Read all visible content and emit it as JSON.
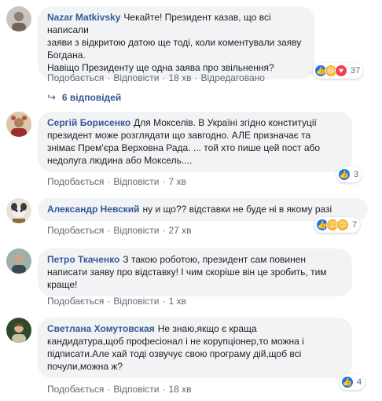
{
  "comments": [
    {
      "author": "Nazar Matkivsky",
      "lines": [
        "Чекайте! Президент казав, що всі написали",
        "заяви з відкритою датою ще тоді, коли коментували заяву",
        "Богдана.",
        "Навіщо Президенту ще одна заява про звільнення?"
      ],
      "like": "Подобається",
      "reply": "Відповісти",
      "time": "18 хв",
      "edited": "Відредаговано",
      "reaction_count": "37"
    },
    {
      "author": "Сергій Борисенко",
      "lines": [
        "Для Мокселів. В Україні згідно конституції",
        "президент може розглядати що завгодно. АЛЕ призначає та",
        "знімає Прем'єра Верховна Рада. ... той хто пише цей пост або",
        "недолуга людина або Моксель...."
      ],
      "like": "Подобається",
      "reply": "Відповісти",
      "time": "7 хв",
      "reaction_count": "3"
    },
    {
      "author": "Александр Невский",
      "lines": [
        "ну и що?? відставки не буде ні в якому разі"
      ],
      "like": "Подобається",
      "reply": "Відповісти",
      "time": "27 хв",
      "reaction_count": "7"
    },
    {
      "author": "Петро Ткаченко",
      "lines": [
        "З такою роботою, президент сам повинен",
        "написати заяву про відставку! І чим скоріше він це зробить, тим",
        "краще!"
      ],
      "like": "Подобається",
      "reply": "Відповісти",
      "time": "1 хв"
    },
    {
      "author": "Светлана Хомутовская",
      "lines": [
        "Не знаю,якщо є краща",
        "кандидатура,щоб професіонал і не корупціонер,то можна і",
        "підписати.Але хай тоді озвучує свою програму дій,щоб всі",
        "почули,можна ж?"
      ],
      "like": "Подобається",
      "reply": "Відповісти",
      "time": "18 хв",
      "reaction_count": "4"
    }
  ],
  "replies_label": "6 відповідей",
  "colors": {
    "link": "#385898",
    "bubble": "#f2f3f5",
    "meta": "#606770",
    "like": "#1877f2"
  }
}
